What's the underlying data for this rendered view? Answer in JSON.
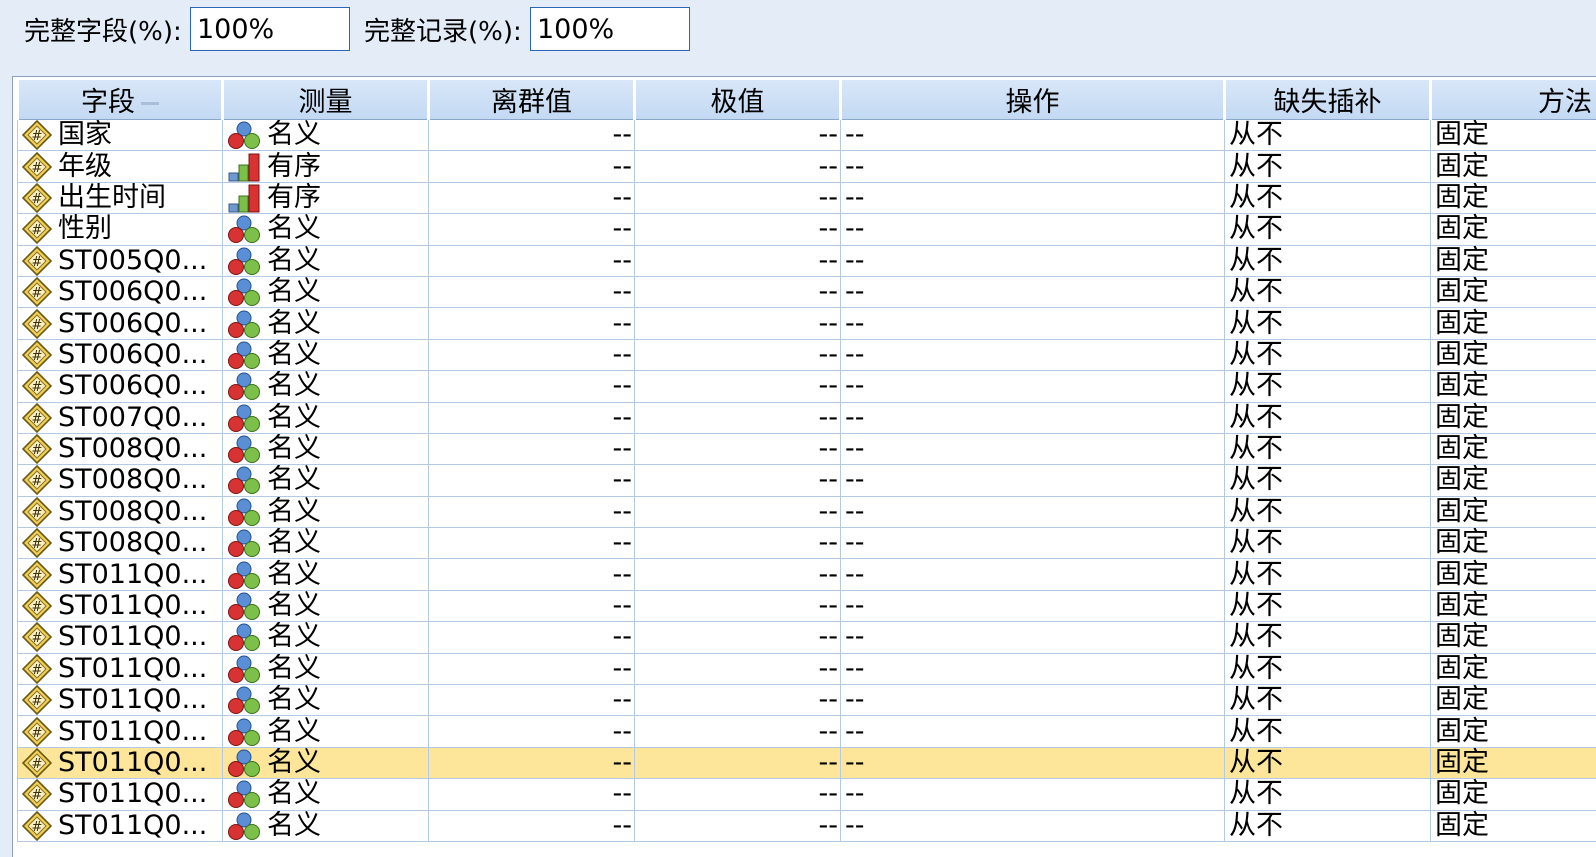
{
  "top": {
    "fields_label": "完整字段(%):",
    "fields_value": "100%",
    "records_label": "完整记录(%):",
    "records_value": "100%"
  },
  "columns": [
    "字段",
    "测量",
    "离群值",
    "极值",
    "操作",
    "缺失插补",
    "方法"
  ],
  "rows": [
    {
      "field": "国家",
      "measure": "名义",
      "mtype": "nominal",
      "outlier": "--",
      "extreme": "--",
      "action": "--",
      "impute": "从不",
      "method": "固定"
    },
    {
      "field": "年级",
      "measure": "有序",
      "mtype": "ordinal",
      "outlier": "--",
      "extreme": "--",
      "action": "--",
      "impute": "从不",
      "method": "固定"
    },
    {
      "field": "出生时间",
      "measure": "有序",
      "mtype": "ordinal",
      "outlier": "--",
      "extreme": "--",
      "action": "--",
      "impute": "从不",
      "method": "固定"
    },
    {
      "field": "性别",
      "measure": "名义",
      "mtype": "nominal",
      "outlier": "--",
      "extreme": "--",
      "action": "--",
      "impute": "从不",
      "method": "固定"
    },
    {
      "field": "ST005Q0...",
      "measure": "名义",
      "mtype": "nominal",
      "outlier": "--",
      "extreme": "--",
      "action": "--",
      "impute": "从不",
      "method": "固定"
    },
    {
      "field": "ST006Q0...",
      "measure": "名义",
      "mtype": "nominal",
      "outlier": "--",
      "extreme": "--",
      "action": "--",
      "impute": "从不",
      "method": "固定"
    },
    {
      "field": "ST006Q0...",
      "measure": "名义",
      "mtype": "nominal",
      "outlier": "--",
      "extreme": "--",
      "action": "--",
      "impute": "从不",
      "method": "固定"
    },
    {
      "field": "ST006Q0...",
      "measure": "名义",
      "mtype": "nominal",
      "outlier": "--",
      "extreme": "--",
      "action": "--",
      "impute": "从不",
      "method": "固定"
    },
    {
      "field": "ST006Q0...",
      "measure": "名义",
      "mtype": "nominal",
      "outlier": "--",
      "extreme": "--",
      "action": "--",
      "impute": "从不",
      "method": "固定"
    },
    {
      "field": "ST007Q0...",
      "measure": "名义",
      "mtype": "nominal",
      "outlier": "--",
      "extreme": "--",
      "action": "--",
      "impute": "从不",
      "method": "固定"
    },
    {
      "field": "ST008Q0...",
      "measure": "名义",
      "mtype": "nominal",
      "outlier": "--",
      "extreme": "--",
      "action": "--",
      "impute": "从不",
      "method": "固定"
    },
    {
      "field": "ST008Q0...",
      "measure": "名义",
      "mtype": "nominal",
      "outlier": "--",
      "extreme": "--",
      "action": "--",
      "impute": "从不",
      "method": "固定"
    },
    {
      "field": "ST008Q0...",
      "measure": "名义",
      "mtype": "nominal",
      "outlier": "--",
      "extreme": "--",
      "action": "--",
      "impute": "从不",
      "method": "固定"
    },
    {
      "field": "ST008Q0...",
      "measure": "名义",
      "mtype": "nominal",
      "outlier": "--",
      "extreme": "--",
      "action": "--",
      "impute": "从不",
      "method": "固定"
    },
    {
      "field": "ST011Q0...",
      "measure": "名义",
      "mtype": "nominal",
      "outlier": "--",
      "extreme": "--",
      "action": "--",
      "impute": "从不",
      "method": "固定"
    },
    {
      "field": "ST011Q0...",
      "measure": "名义",
      "mtype": "nominal",
      "outlier": "--",
      "extreme": "--",
      "action": "--",
      "impute": "从不",
      "method": "固定"
    },
    {
      "field": "ST011Q0...",
      "measure": "名义",
      "mtype": "nominal",
      "outlier": "--",
      "extreme": "--",
      "action": "--",
      "impute": "从不",
      "method": "固定"
    },
    {
      "field": "ST011Q0...",
      "measure": "名义",
      "mtype": "nominal",
      "outlier": "--",
      "extreme": "--",
      "action": "--",
      "impute": "从不",
      "method": "固定"
    },
    {
      "field": "ST011Q0...",
      "measure": "名义",
      "mtype": "nominal",
      "outlier": "--",
      "extreme": "--",
      "action": "--",
      "impute": "从不",
      "method": "固定"
    },
    {
      "field": "ST011Q0...",
      "measure": "名义",
      "mtype": "nominal",
      "outlier": "--",
      "extreme": "--",
      "action": "--",
      "impute": "从不",
      "method": "固定"
    },
    {
      "field": "ST011Q0...",
      "measure": "名义",
      "mtype": "nominal",
      "outlier": "--",
      "extreme": "--",
      "action": "--",
      "impute": "从不",
      "method": "固定",
      "selected": true
    },
    {
      "field": "ST011Q0...",
      "measure": "名义",
      "mtype": "nominal",
      "outlier": "--",
      "extreme": "--",
      "action": "--",
      "impute": "从不",
      "method": "固定"
    },
    {
      "field": "ST011Q0...",
      "measure": "名义",
      "mtype": "nominal",
      "outlier": "--",
      "extreme": "--",
      "action": "--",
      "impute": "从不",
      "method": "固定"
    }
  ],
  "icons": {
    "field_type": "numeric-field-icon",
    "nominal": "nominal-measure-icon",
    "ordinal": "ordinal-measure-icon",
    "sort": "sort-indicator-icon"
  },
  "colors": {
    "selected_row": "#fde59a",
    "header_bg": "#c9ddf4",
    "grid_line": "#b4cae4",
    "input_border": "#2a66b8"
  }
}
